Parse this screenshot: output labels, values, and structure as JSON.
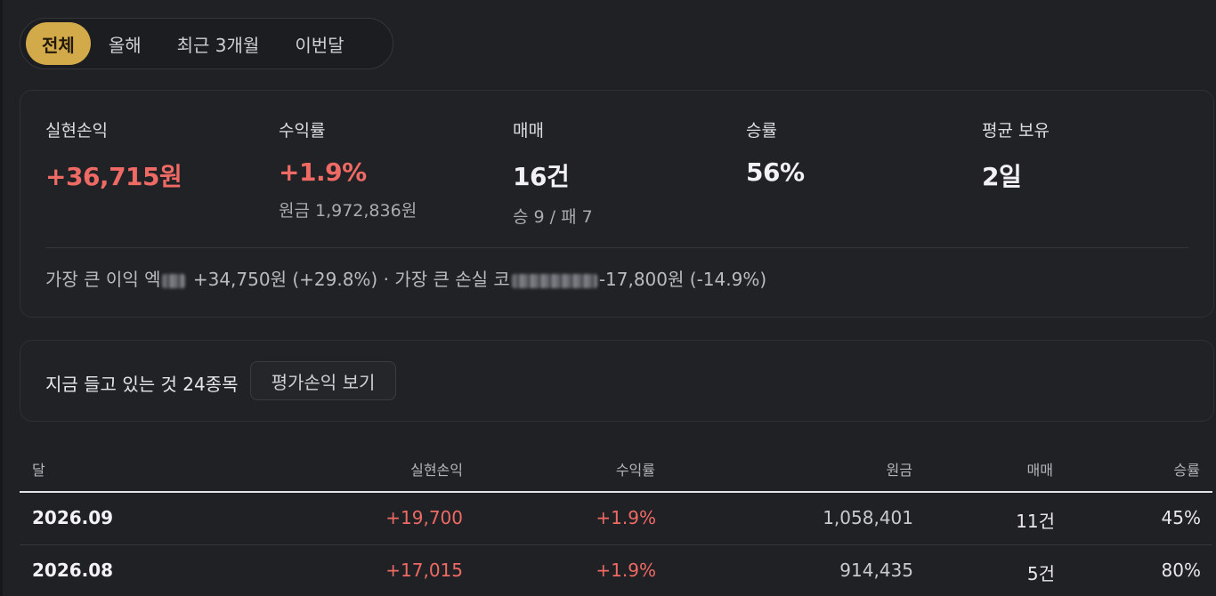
{
  "tabs": [
    {
      "label": "전체",
      "active": true
    },
    {
      "label": "올해",
      "active": false
    },
    {
      "label": "최근 3개월",
      "active": false
    },
    {
      "label": "이번달",
      "active": false
    }
  ],
  "summary": {
    "realized": {
      "label": "실현손익",
      "value": "+36,715원"
    },
    "return": {
      "label": "수익률",
      "value": "+1.9%",
      "sub": "원금 1,972,836원"
    },
    "trades": {
      "label": "매매",
      "value": "16건",
      "sub": "승 9 / 패 7"
    },
    "winrate": {
      "label": "승률",
      "value": "56%"
    },
    "avg_hold": {
      "label": "평균 보유",
      "value": "2일"
    },
    "best_prefix": "가장 큰 이익 엑",
    "best_detail": "+34,750원 (+29.8%)",
    "separator": "·",
    "worst_prefix": "가장 큰 손실 코",
    "worst_detail": "-17,800원 (-14.9%)"
  },
  "holdings": {
    "text": "지금 들고 있는 것 24종목",
    "button": "평가손익 보기"
  },
  "table": {
    "headers": {
      "month": "달",
      "realized": "실현손익",
      "return": "수익률",
      "principal": "원금",
      "trades": "매매",
      "winrate": "승률"
    },
    "rows": [
      {
        "month": "2026.09",
        "realized": "+19,700",
        "return": "+1.9%",
        "principal": "1,058,401",
        "trades": "11건",
        "winrate": "45%"
      },
      {
        "month": "2026.08",
        "realized": "+17,015",
        "return": "+1.9%",
        "principal": "914,435",
        "trades": "5건",
        "winrate": "80%"
      }
    ]
  },
  "colors": {
    "accent": "#d2aa4a",
    "positive": "#ef6a64",
    "background": "#1f2125"
  }
}
